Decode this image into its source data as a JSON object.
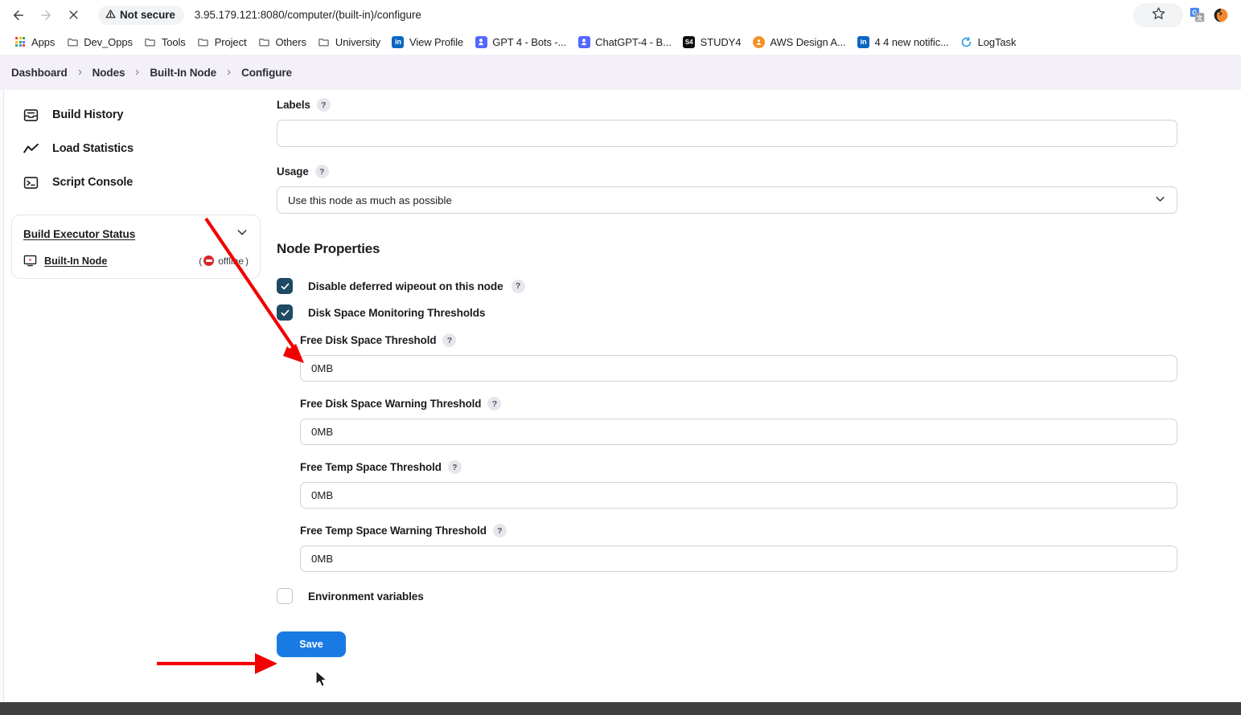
{
  "browser": {
    "back_icon": "arrow-left-icon",
    "forward_icon": "arrow-right-icon",
    "stop_icon": "close-x-icon",
    "security_label": "Not secure",
    "url": "3.95.179.121:8080/computer/(built-in)/configure",
    "bookmark_star_icon": "star-icon",
    "extensions": [
      {
        "name": "google-translate-extension",
        "label": "G"
      },
      {
        "name": "grammarly-extension",
        "label": ""
      }
    ]
  },
  "bookmarks": [
    {
      "label": "Apps",
      "icon": "apps-grid-icon",
      "color": ""
    },
    {
      "label": "Dev_Opps",
      "icon": "folder-icon",
      "color": ""
    },
    {
      "label": "Tools",
      "icon": "folder-icon",
      "color": ""
    },
    {
      "label": "Project",
      "icon": "folder-icon",
      "color": ""
    },
    {
      "label": "Others",
      "icon": "folder-icon",
      "color": ""
    },
    {
      "label": "University",
      "icon": "folder-icon",
      "color": ""
    },
    {
      "label": "View Profile",
      "icon": "linkedin-icon",
      "color": "#0a66c2"
    },
    {
      "label": "GPT 4 - Bots -...",
      "icon": "openai-bot-icon",
      "color": "#5468ff"
    },
    {
      "label": "ChatGPT-4 - B...",
      "icon": "openai-bot-icon",
      "color": "#5468ff"
    },
    {
      "label": "STUDY4",
      "icon": "study4-icon",
      "color": "#111111"
    },
    {
      "label": "AWS Design A...",
      "icon": "aws-icon",
      "color": "#f59026"
    },
    {
      "label": "4 4 new notific...",
      "icon": "linkedin-icon",
      "color": "#0a66c2"
    },
    {
      "label": "LogTask",
      "icon": "logtask-icon",
      "color": "#2e9fe0"
    }
  ],
  "breadcrumb": {
    "separator": "›",
    "items": [
      "Dashboard",
      "Nodes",
      "Built-In Node",
      "Configure"
    ]
  },
  "sidebar": {
    "items": [
      {
        "label": "Build History",
        "icon": "inbox-icon"
      },
      {
        "label": "Load Statistics",
        "icon": "line-chart-icon"
      },
      {
        "label": "Script Console",
        "icon": "terminal-icon"
      }
    ],
    "executor_panel": {
      "title": "Build Executor Status",
      "collapse_icon": "chevron-down-icon",
      "node_label": "Built-In Node",
      "node_icon": "computer-error-icon",
      "status_prefix": "(",
      "status_text": "offline",
      "status_suffix": ")",
      "status_color": "#d7262a"
    }
  },
  "form": {
    "labels_field": {
      "label": "Labels",
      "help_icon": "?",
      "value": "",
      "placeholder": ""
    },
    "usage_field": {
      "label": "Usage",
      "help_icon": "?",
      "value": "Use this node as much as possible",
      "chevron_icon": "chevron-down-icon"
    },
    "node_properties_title": "Node Properties",
    "checkboxes": [
      {
        "label": "Disable deferred wipeout on this node",
        "checked": true,
        "has_help": true,
        "help_icon": "?"
      },
      {
        "label": "Disk Space Monitoring Thresholds",
        "checked": true,
        "has_help": false,
        "help_icon": ""
      }
    ],
    "thresholds": [
      {
        "label": "Free Disk Space Threshold",
        "help_icon": "?",
        "value": "0MB"
      },
      {
        "label": "Free Disk Space Warning Threshold",
        "help_icon": "?",
        "value": "0MB"
      },
      {
        "label": "Free Temp Space Threshold",
        "help_icon": "?",
        "value": "0MB"
      },
      {
        "label": "Free Temp Space Warning Threshold",
        "help_icon": "?",
        "value": "0MB"
      }
    ],
    "env_checkbox": {
      "label": "Environment variables",
      "checked": false
    },
    "save_button": {
      "label": "Save",
      "color": "#1a7ae4"
    }
  },
  "annotations": {
    "arrow_color": "#f20000",
    "pointer_arrow_target": "Free Disk Space Threshold input",
    "save_arrow_target": "Save button"
  }
}
